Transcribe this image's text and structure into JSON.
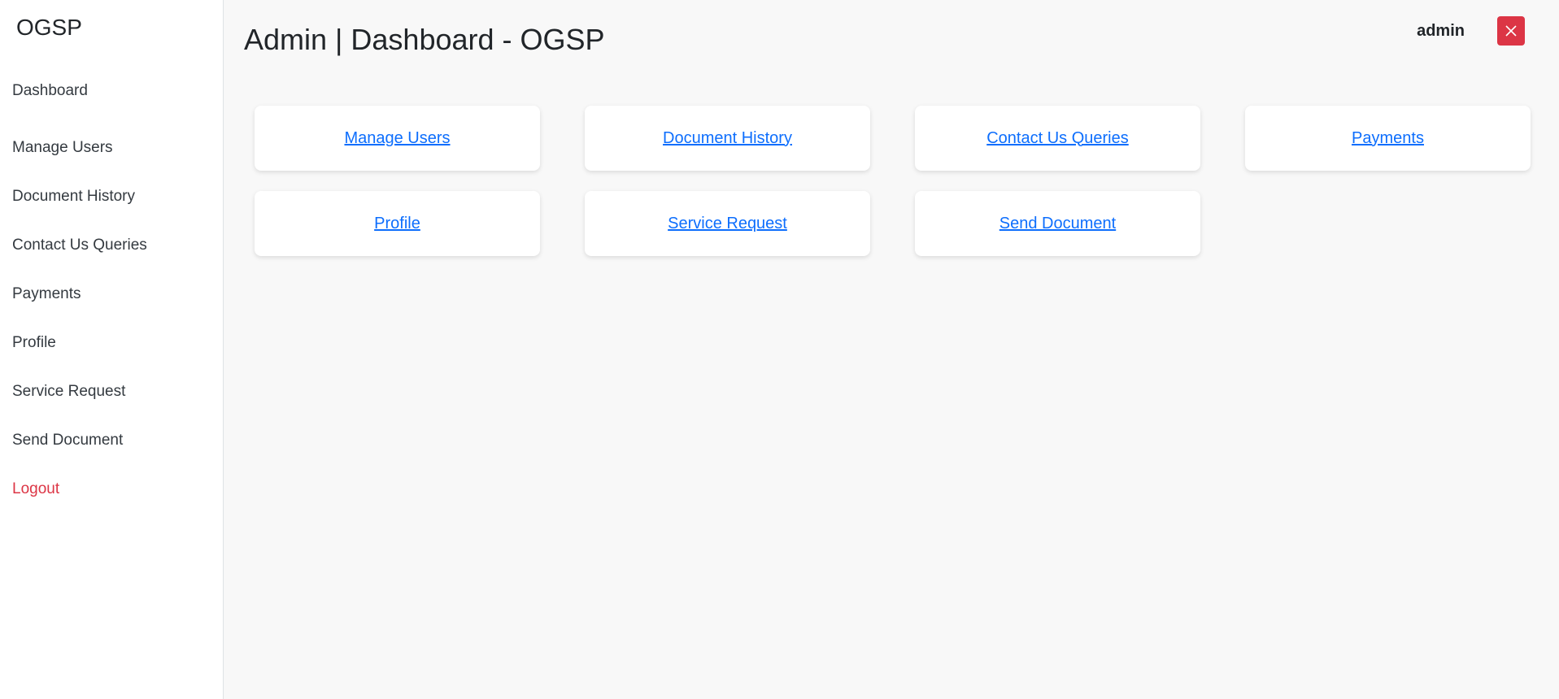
{
  "brand": "OGSP",
  "sidebar": {
    "items": [
      {
        "label": "Dashboard"
      },
      {
        "label": "Manage Users"
      },
      {
        "label": "Document History"
      },
      {
        "label": "Contact Us Queries"
      },
      {
        "label": "Payments"
      },
      {
        "label": "Profile"
      },
      {
        "label": "Service Request"
      },
      {
        "label": "Send Document"
      },
      {
        "label": "Logout"
      }
    ]
  },
  "header": {
    "title": "Admin | Dashboard - OGSP",
    "username": "admin",
    "close_icon": "close-icon"
  },
  "cards": [
    {
      "label": "Manage Users"
    },
    {
      "label": "Document History"
    },
    {
      "label": "Contact Us Queries"
    },
    {
      "label": "Payments"
    },
    {
      "label": "Profile"
    },
    {
      "label": "Service Request"
    },
    {
      "label": "Send Document"
    }
  ],
  "colors": {
    "logout": "#dc3545",
    "close_button": "#dc3545",
    "link": "#0d6efd"
  }
}
